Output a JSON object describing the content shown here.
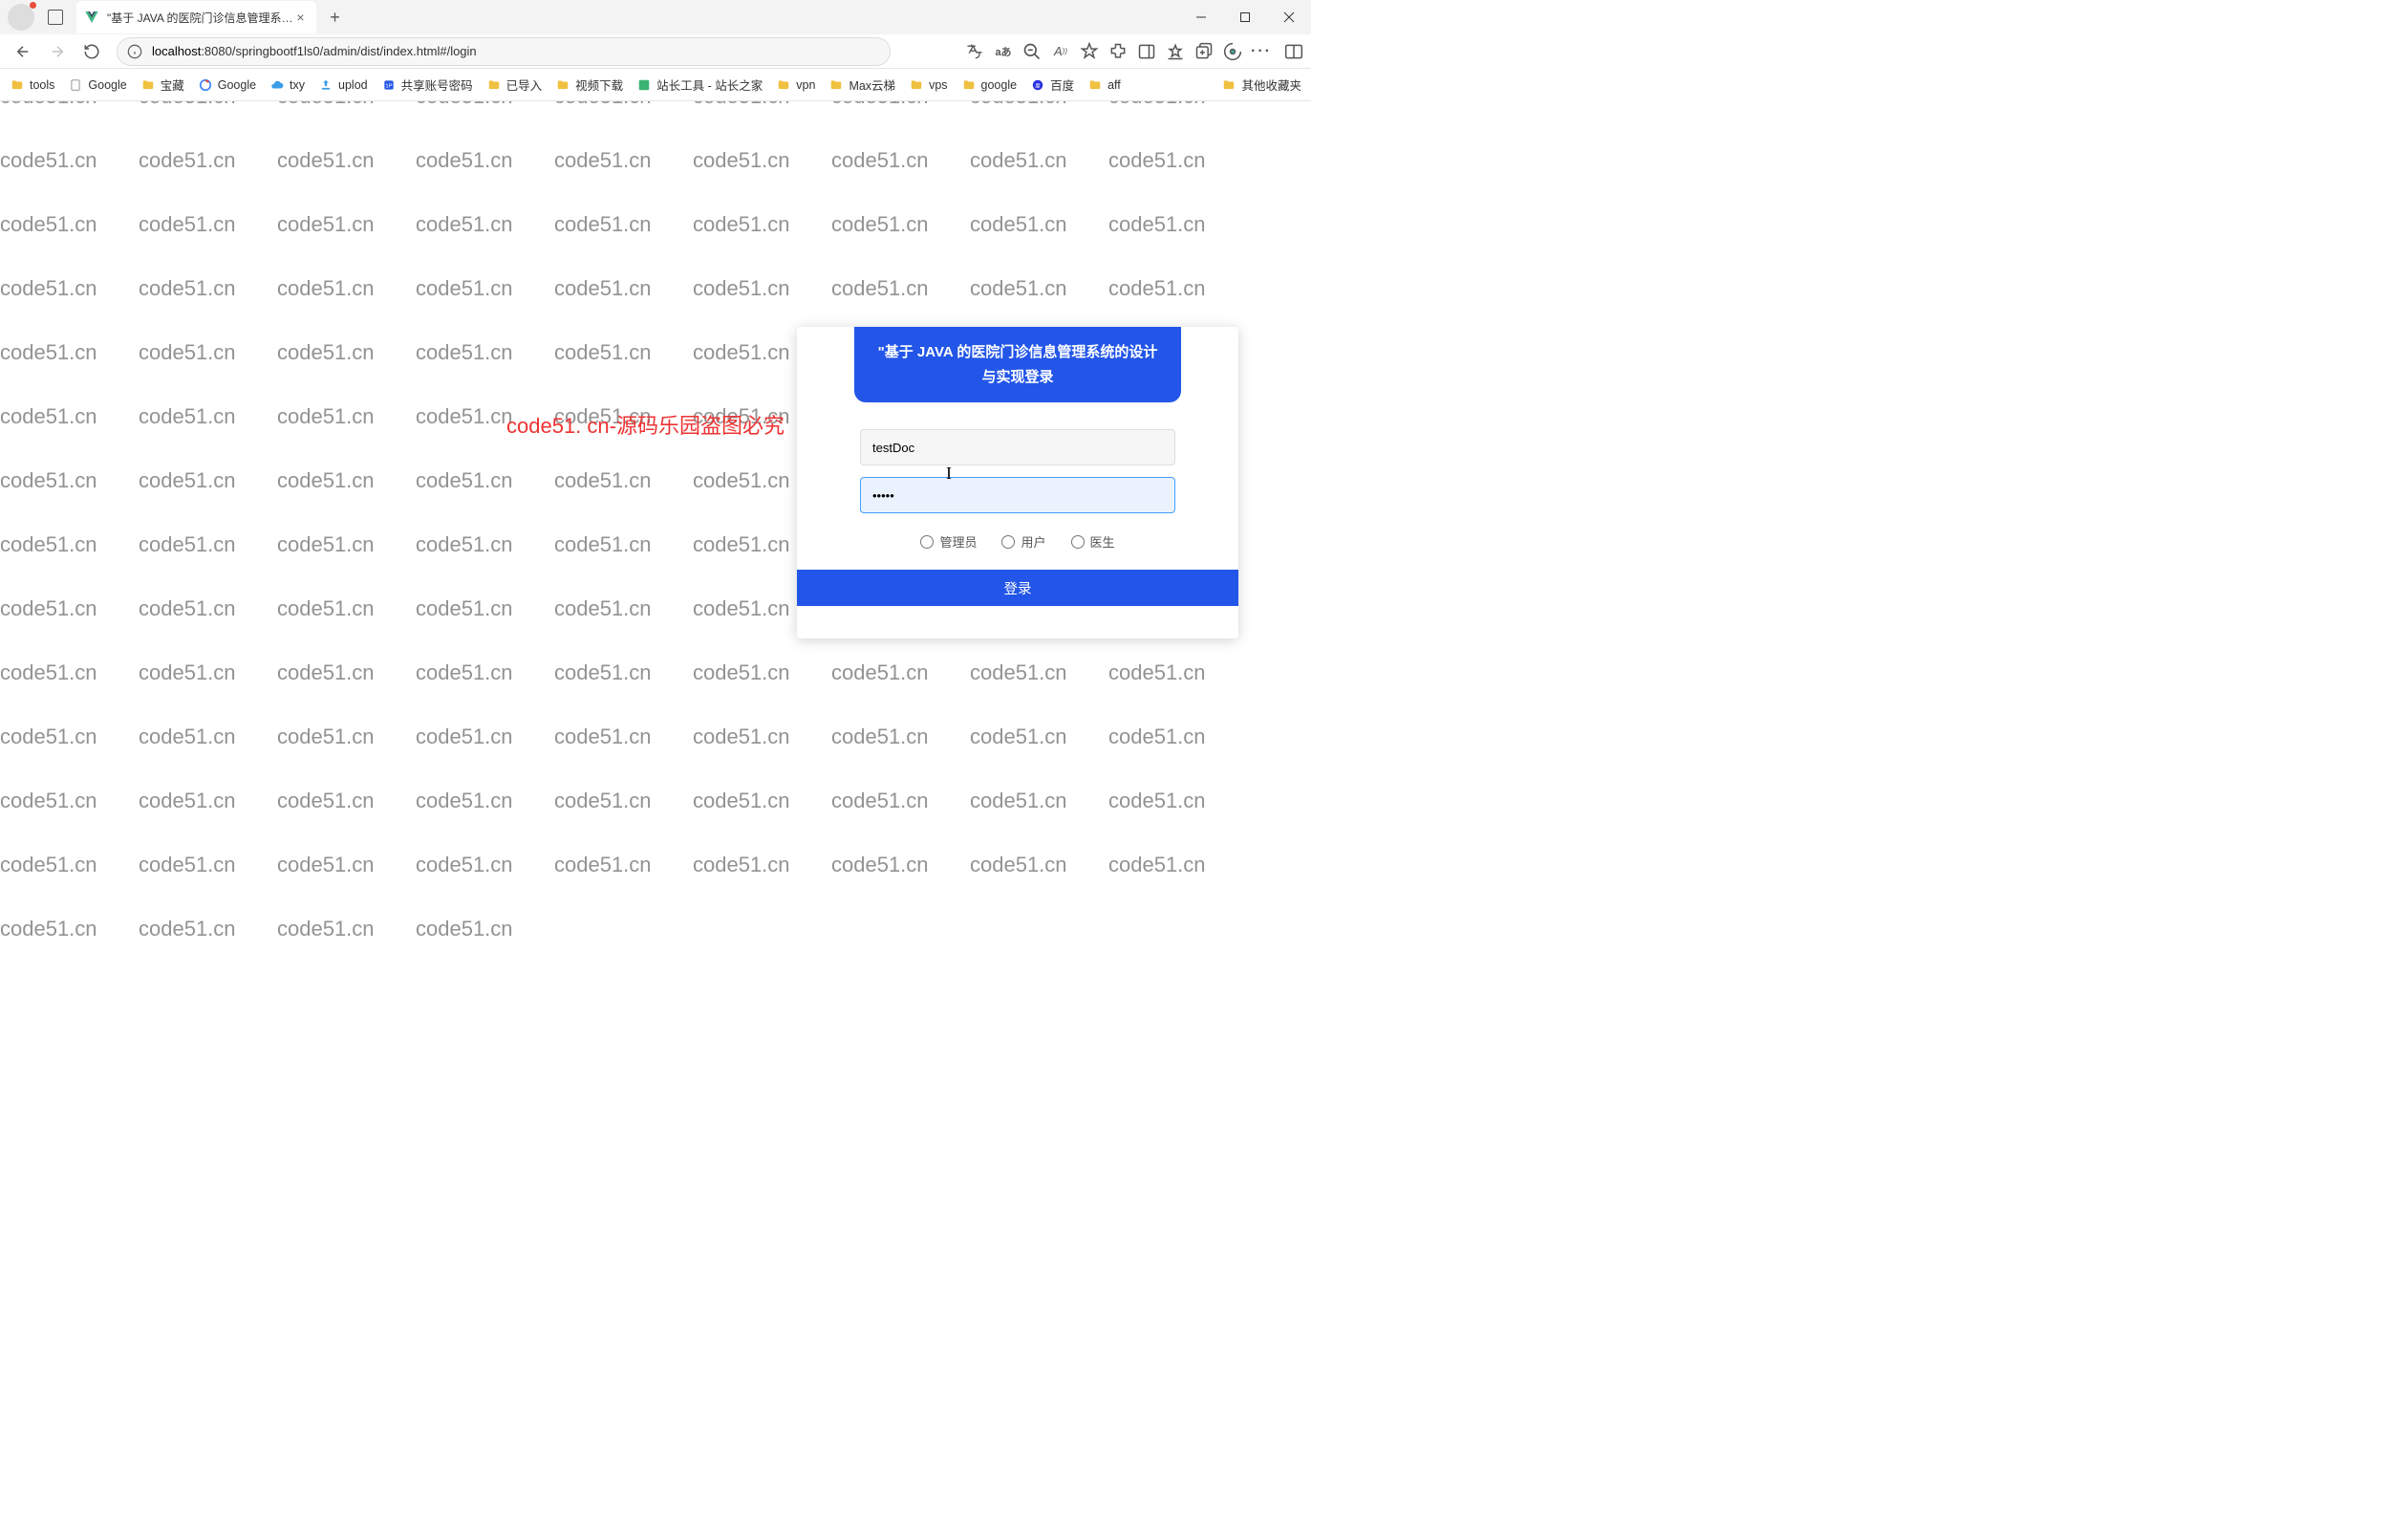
{
  "browser": {
    "tab_title": "\"基于 JAVA 的医院门诊信息管理系…",
    "url_host": "localhost",
    "url_path": ":8080/springbootf1ls0/admin/dist/index.html#/login"
  },
  "bookmarks": {
    "items": [
      {
        "label": "tools",
        "icon": "folder"
      },
      {
        "label": "Google",
        "icon": "page"
      },
      {
        "label": "宝藏",
        "icon": "folder"
      },
      {
        "label": "Google",
        "icon": "google"
      },
      {
        "label": "txy",
        "icon": "cloud"
      },
      {
        "label": "uplod",
        "icon": "upload"
      },
      {
        "label": "共享账号密码",
        "icon": "pass"
      },
      {
        "label": "已导入",
        "icon": "folder"
      },
      {
        "label": "视频下载",
        "icon": "folder"
      },
      {
        "label": "站长工具 - 站长之家",
        "icon": "tool"
      },
      {
        "label": "vpn",
        "icon": "folder"
      },
      {
        "label": "Max云梯",
        "icon": "folder"
      },
      {
        "label": "vps",
        "icon": "folder"
      },
      {
        "label": "google",
        "icon": "folder"
      },
      {
        "label": "百度",
        "icon": "baidu"
      },
      {
        "label": "aff",
        "icon": "folder"
      }
    ],
    "overflow": "其他收藏夹"
  },
  "login": {
    "title": "\"基于 JAVA 的医院门诊信息管理系统的设计与实现登录",
    "username": "testDoc",
    "password": "•••••",
    "roles": [
      {
        "label": "管理员"
      },
      {
        "label": "用户"
      },
      {
        "label": "医生"
      }
    ],
    "submit": "登录"
  },
  "watermark_text": "code51.cn",
  "center_notice": "code51. cn-源码乐园盗图必究"
}
